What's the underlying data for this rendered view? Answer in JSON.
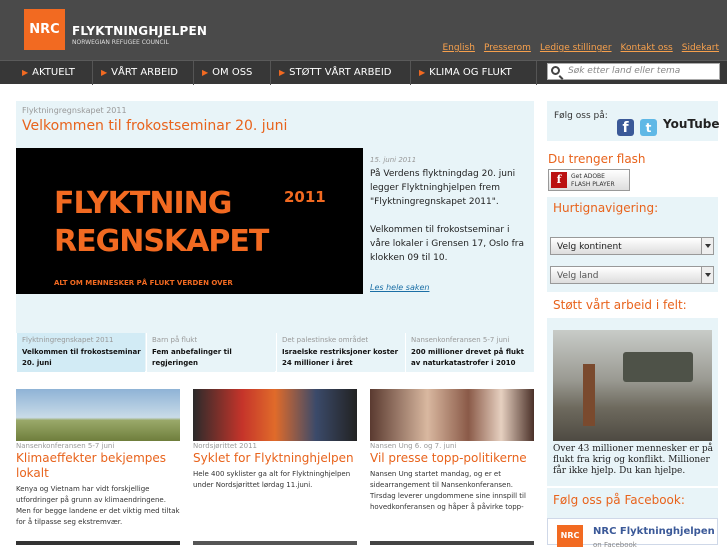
{
  "header": {
    "logo": "NRC",
    "name": "FLYKTNINGHJELPEN",
    "subname": "NORWEGIAN REFUGEE COUNCIL",
    "links": [
      "English",
      "Presserom",
      "Ledige stillinger",
      "Kontakt oss",
      "Sidekart"
    ]
  },
  "nav": {
    "items": [
      "AKTUELT",
      "VÅRT ARBEID",
      "OM OSS",
      "STØTT VÅRT ARBEID",
      "KLIMA OG FLUKT"
    ],
    "search_placeholder": "Søk etter land eller tema"
  },
  "featured": {
    "section": "Flyktningregnskapet 2011",
    "title": "Velkommen til frokostseminar 20. juni",
    "banner_line1": "FLYKTNING",
    "banner_line2": "REGNSKAPET",
    "banner_year": "2011",
    "banner_sub": "ALT OM MENNESKER PÅ FLUKT VERDEN OVER",
    "date": "15. juni 2011",
    "para1": "På Verdens flyktningdag 20. juni legger Flyktninghjelpen frem \"Flyktningregnskapet 2011\".",
    "para2": "Velkommen til frokostseminar i våre lokaler i Grensen 17, Oslo fra klokken 09 til 10.",
    "more": "Les hele saken"
  },
  "tabs": [
    {
      "section": "Flyktningregnskapet 2011",
      "title": "Velkommen til frokostseminar 20. juni"
    },
    {
      "section": "Barn på flukt",
      "title": "Fem anbefalinger til regjeringen"
    },
    {
      "section": "Det palestinske området",
      "title": "Israelske restriksjoner koster 24 millioner i året"
    },
    {
      "section": "Nansenkonferansen 5-7 juni",
      "title": "200 millioner drevet på flukt av naturkatastrofer i 2010"
    }
  ],
  "cards": [
    {
      "section": "Nansenkonferansen 5-7 juni",
      "title": "Klimaeffekter bekjempes lokalt",
      "text": "Kenya og Vietnam har vidt forskjellige utfordringer på grunn av klimaendringene. Men for begge landene er det viktig med tiltak for å tilpasse seg ekstremvær."
    },
    {
      "section": "Nordsjørittet 2011",
      "title": "Syklet for Flyktninghjelpen",
      "text": "Hele 400 syklister ga alt for Flyktninghjelpen under Nordsjørittet lørdag 11.juni."
    },
    {
      "section": "Nansen Ung 6. og 7. juni",
      "title": "Vil presse topp-politikerne",
      "text": "Nansen Ung startet mandag, og er et sidearrangement til Nansenkonferansen. Tirsdag leverer ungdommene sine innspill til hovedkonferansen og håper å påvirke topp-"
    }
  ],
  "sidebar": {
    "follow": "Følg oss på:",
    "flash_heading": "Du trenger flash",
    "flash_btn_line1": "Get ADOBE",
    "flash_btn_line2": "FLASH PLAYER",
    "quicknav": "Hurtignavigering:",
    "select_continent": "Velg kontinent",
    "select_country": "Velg land",
    "support_heading": "Støtt vårt arbeid i felt:",
    "support_text": "Over 43 millioner mennesker er på flukt fra krig og konflikt. Millioner får ikke hjelp. Du kan hjelpe.",
    "facebook_heading": "Følg oss på Facebook:",
    "fb_name": "NRC Flyktninghjelpen",
    "fb_sub": "on Facebook",
    "youtube": "YouTube"
  },
  "colors": {
    "accent": "#e8631c",
    "header_bg": "#4a4a4a",
    "panel_bg": "#e8f4f8"
  }
}
